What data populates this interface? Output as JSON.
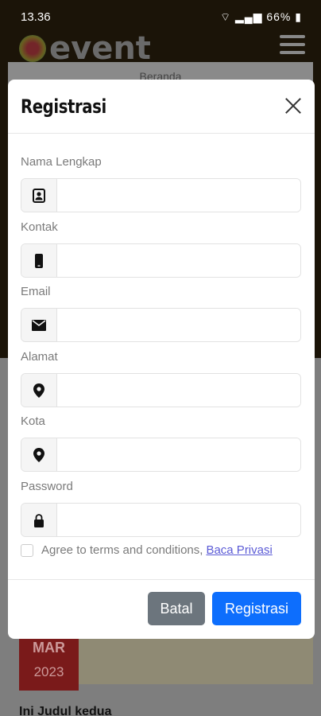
{
  "status_bar": {
    "time": "13.36",
    "battery": "66%"
  },
  "app": {
    "logo_text": "event",
    "nav_label": "Beranda"
  },
  "background": {
    "badge_month": "MAR",
    "badge_year": "2023",
    "post_title": "Ini Judul kedua"
  },
  "modal": {
    "title": "Registrasi",
    "fields": [
      {
        "label": "Nama Lengkap",
        "icon": "contact-card-icon",
        "value": "",
        "placeholder": ""
      },
      {
        "label": "Kontak",
        "icon": "mobile-phone-icon",
        "value": "",
        "placeholder": ""
      },
      {
        "label": "Email",
        "icon": "envelope-icon",
        "value": "",
        "placeholder": ""
      },
      {
        "label": "Alamat",
        "icon": "location-pin-icon",
        "value": "",
        "placeholder": ""
      },
      {
        "label": "Kota",
        "icon": "location-pin-icon",
        "value": "",
        "placeholder": ""
      },
      {
        "label": "Password",
        "icon": "lock-icon",
        "value": "",
        "placeholder": ""
      }
    ],
    "terms_text": "Agree to terms and conditions,",
    "privacy_link": "Baca Privasi",
    "cancel_label": "Batal",
    "submit_label": "Registrasi"
  },
  "colors": {
    "primary": "#0d6efd",
    "secondary": "#6c757d",
    "link": "#5b5bd6"
  }
}
